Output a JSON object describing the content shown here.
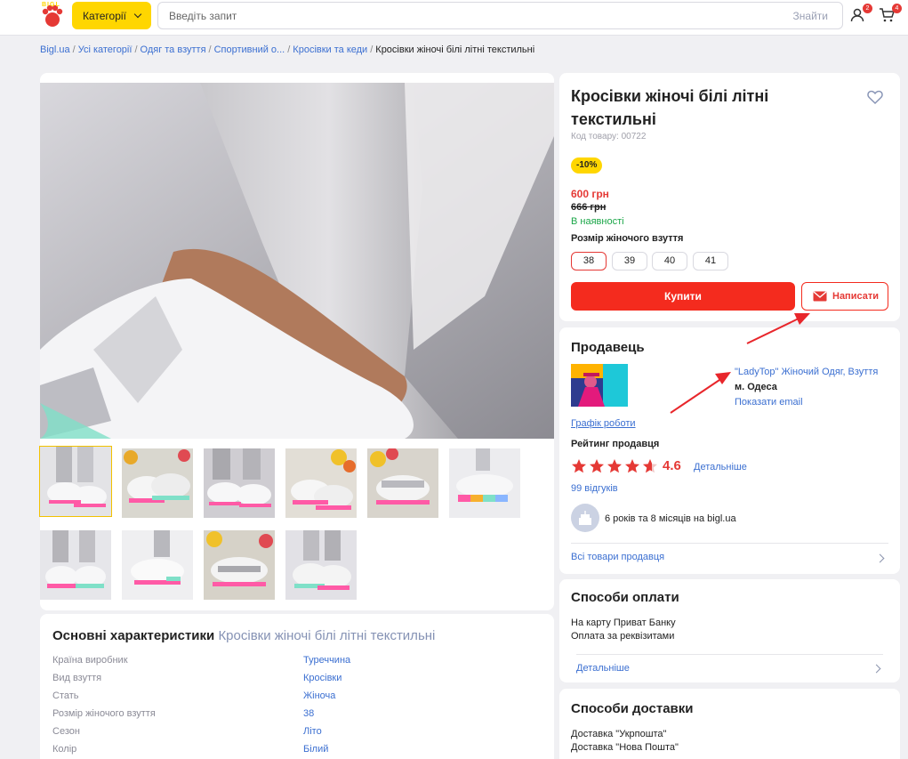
{
  "header": {
    "logo_text": "BIGL",
    "categories_label": "Категорії",
    "search_placeholder": "Введіть запит",
    "search_button": "Знайти",
    "profile_badge": "2",
    "cart_badge": "4"
  },
  "breadcrumbs": {
    "items": [
      "Bigl.ua",
      "Усі категорії",
      "Одяг та взуття",
      "Спортивний о...",
      "Кросівки та кеди"
    ],
    "current": "Кросівки жіночі білі літні текстильні"
  },
  "product": {
    "title": "Кросівки жіночі білі літні текстильні",
    "code": "Код товару: 00722",
    "discount": "-10%",
    "price": "600 грн",
    "old_price": "666 грн",
    "stock": "В наявності",
    "size_label": "Розмір жіночого взуття",
    "sizes": [
      "38",
      "39",
      "40",
      "41"
    ],
    "selected_size": "38",
    "buy_label": "Купити",
    "write_label": "Написати"
  },
  "seller": {
    "heading": "Продавець",
    "name": "\"LadyTop\" Жіночий Одяг, Взуття",
    "city": "м. Одеса",
    "email_link": "Показати email",
    "schedule_link": "Графік роботи",
    "rating_label": "Рейтинг продавця",
    "rating": "4.6",
    "rating_value": 4.6,
    "details_link": "Детальніше",
    "reviews": "99 відгуків",
    "tenure": "6 років та 8 місяців на bigl.ua",
    "all_goods": "Всі товари продавця"
  },
  "payment": {
    "heading": "Способи оплати",
    "items": [
      "На карту Приват Банку",
      "Оплата за реквізитами"
    ],
    "details_link": "Детальніше"
  },
  "delivery": {
    "heading": "Способи доставки",
    "items": [
      "Доставка \"Укрпошта\"",
      "Доставка \"Нова Пошта\""
    ]
  },
  "specs": {
    "heading": "Основні характеристики",
    "subheading": "Кросівки жіночі білі літні текстильні",
    "rows": [
      {
        "key": "Країна виробник",
        "value": "Туреччина"
      },
      {
        "key": "Вид взуття",
        "value": "Кросівки"
      },
      {
        "key": "Стать",
        "value": "Жіноча"
      },
      {
        "key": "Розмір жіночого взуття",
        "value": "38"
      },
      {
        "key": "Сезон",
        "value": "Літо"
      },
      {
        "key": "Колір",
        "value": "Білий"
      }
    ]
  },
  "colors": {
    "accent_red": "#f42b1e",
    "brand_yellow": "#ffd600",
    "link_blue": "#3b6fd1",
    "stock_green": "#1aa648"
  }
}
